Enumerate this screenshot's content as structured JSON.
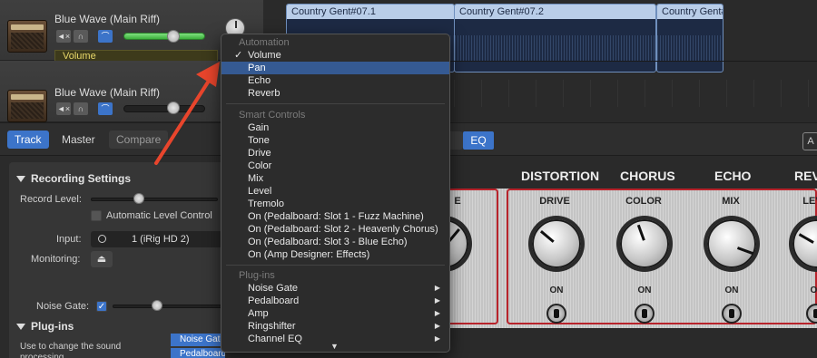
{
  "tracks": [
    {
      "name": "Blue Wave (Main Riff)",
      "automation_param": "Volume",
      "volume_fraction": 0.75
    },
    {
      "name": "Blue Wave (Main Riff)",
      "volume_fraction": 0.75
    }
  ],
  "track_buttons": {
    "mute": "◄×",
    "solo": "∩",
    "automation": "⌒"
  },
  "regions": [
    "Country Gent#07.1",
    "Country Gent#07.2",
    "Country Gent#"
  ],
  "tabs": {
    "track": "Track",
    "master": "Master",
    "compare": "Compare",
    "eq": "EQ",
    "corner": "A"
  },
  "inspector": {
    "recording_settings": "Recording Settings",
    "record_level": "Record Level:",
    "automatic_level_control": "Automatic Level Control",
    "input_label": "Input:",
    "input_value": "1  (iRig HD 2)",
    "monitoring_label": "Monitoring:",
    "noise_gate_label": "Noise Gate:",
    "plugins_header": "Plug-ins",
    "plugins_desc": "Use to change the sound processing",
    "plugin_slots": [
      "Noise Gate",
      "Pedalboard"
    ]
  },
  "amp": {
    "sections": [
      "DISTORTION",
      "CHORUS",
      "ECHO",
      "REV"
    ],
    "left_partial_label": "E",
    "knobs": [
      "DRIVE",
      "COLOR",
      "MIX",
      "LEV"
    ],
    "on_label": "ON"
  },
  "menu": {
    "automation_header": "Automation",
    "automation_items": [
      "Volume",
      "Pan",
      "Echo",
      "Reverb"
    ],
    "checked_item": "Volume",
    "highlighted_item": "Pan",
    "smart_controls_header": "Smart Controls",
    "smart_controls_items": [
      "Gain",
      "Tone",
      "Drive",
      "Color",
      "Mix",
      "Level",
      "Tremolo",
      "On (Pedalboard: Slot 1 - Fuzz Machine)",
      "On (Pedalboard: Slot 2 - Heavenly Chorus)",
      "On (Pedalboard: Slot 3 - Blue Echo)",
      "On (Amp Designer: Effects)"
    ],
    "plugins_header": "Plug-ins",
    "plugins_items": [
      "Noise Gate",
      "Pedalboard",
      "Amp",
      "Ringshifter",
      "Channel EQ"
    ],
    "check_glyph": "✓",
    "submenu_glyph": "▶",
    "more_glyph": "▼"
  },
  "colors": {
    "accent": "#3c74c9",
    "highlight": "#355a93",
    "amp_red": "#b8232b",
    "arrow": "#e8452c"
  }
}
